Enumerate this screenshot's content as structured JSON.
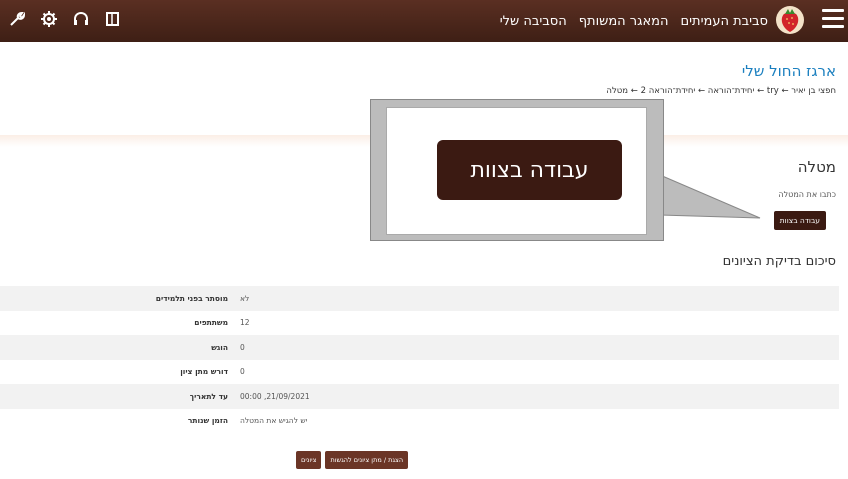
{
  "topbar": {
    "nav": [
      "הסביבה שלי",
      "המאגר המשותף",
      "סביבת העמיתים"
    ],
    "icons": [
      "wrench-icon",
      "gear-icon",
      "headset-icon",
      "book-icon"
    ]
  },
  "header": {
    "course_title": "ארגז החול שלי",
    "breadcrumb": "חפצי בן יאיר ← try ← יחידת־הוראה ← יחידת־הוראה 2 ← מטלה"
  },
  "assignment": {
    "title": "מטלה",
    "description": "כתבו את המטלה",
    "group_button": "עבודה בצוות"
  },
  "summary": {
    "title": "סיכום בדיקת הציונים",
    "rows": [
      {
        "label": "מוסתר בפני תלמידים",
        "value": "לא"
      },
      {
        "label": "משתתפים",
        "value": "12"
      },
      {
        "label": "הוגש",
        "value": "0"
      },
      {
        "label": "דורש מתן ציון",
        "value": "0"
      },
      {
        "label": "עד לתאריך",
        "value": "21/09/2021, 00:00"
      },
      {
        "label": "הזמן שנותר",
        "value": "יש להגיש את המטלה"
      }
    ]
  },
  "footer": {
    "grade_button": "הצגת / מתן ציונים להגשות",
    "grades_button": "ציונים"
  },
  "callout": {
    "label": "עבודה בצוות"
  }
}
